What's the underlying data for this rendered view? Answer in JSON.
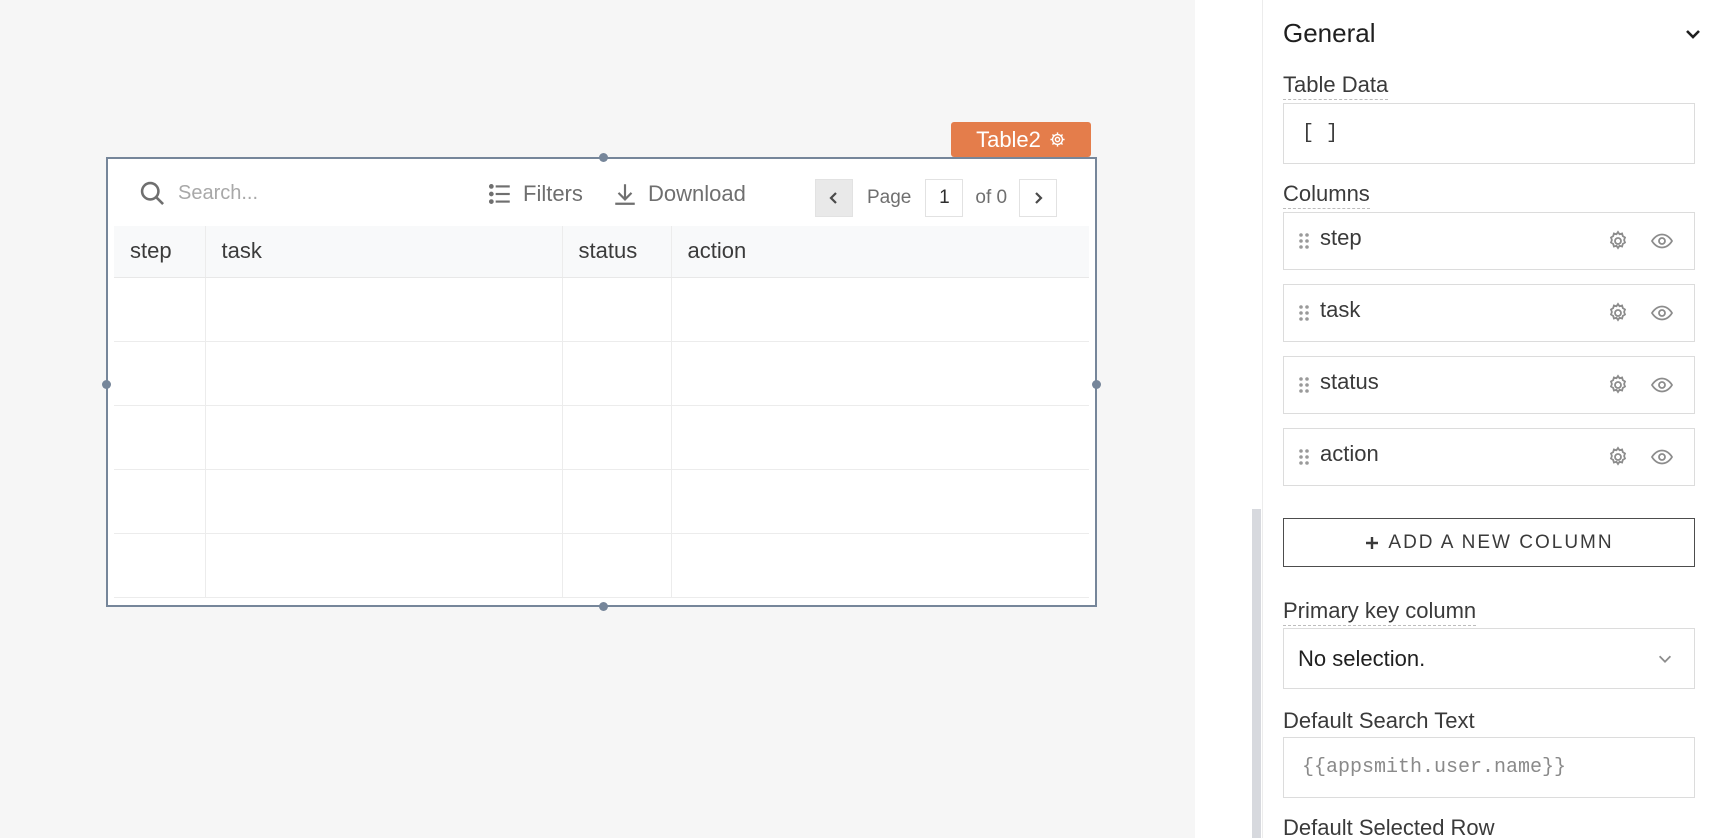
{
  "widget": {
    "name": "Table2"
  },
  "table": {
    "search_placeholder": "Search...",
    "filters_label": "Filters",
    "download_label": "Download",
    "pagination": {
      "page_label": "Page",
      "current_page": "1",
      "of_label": "of 0"
    },
    "columns": [
      "step",
      "task",
      "status",
      "action"
    ],
    "empty_rows": 5
  },
  "pane": {
    "section_title": "General",
    "table_data_label": "Table Data",
    "table_data_value": "[ ]",
    "columns_label": "Columns",
    "columns": [
      {
        "name": "step"
      },
      {
        "name": "task"
      },
      {
        "name": "status"
      },
      {
        "name": "action"
      }
    ],
    "add_column_label": "ADD A NEW COLUMN",
    "primary_key_label": "Primary key column",
    "primary_key_value": "No selection.",
    "default_search_label": "Default Search Text",
    "default_search_placeholder": "{{appsmith.user.name}}",
    "default_selected_row_label": "Default Selected Row"
  },
  "colors": {
    "accent": "#e47d4b",
    "frame": "#76869a"
  },
  "icons": [
    "search-icon",
    "filter-icon",
    "download-icon",
    "chevron-left-icon",
    "chevron-right-icon",
    "gear-icon",
    "eye-icon",
    "drag-handle-icon",
    "chevron-down-icon",
    "plus-icon"
  ]
}
